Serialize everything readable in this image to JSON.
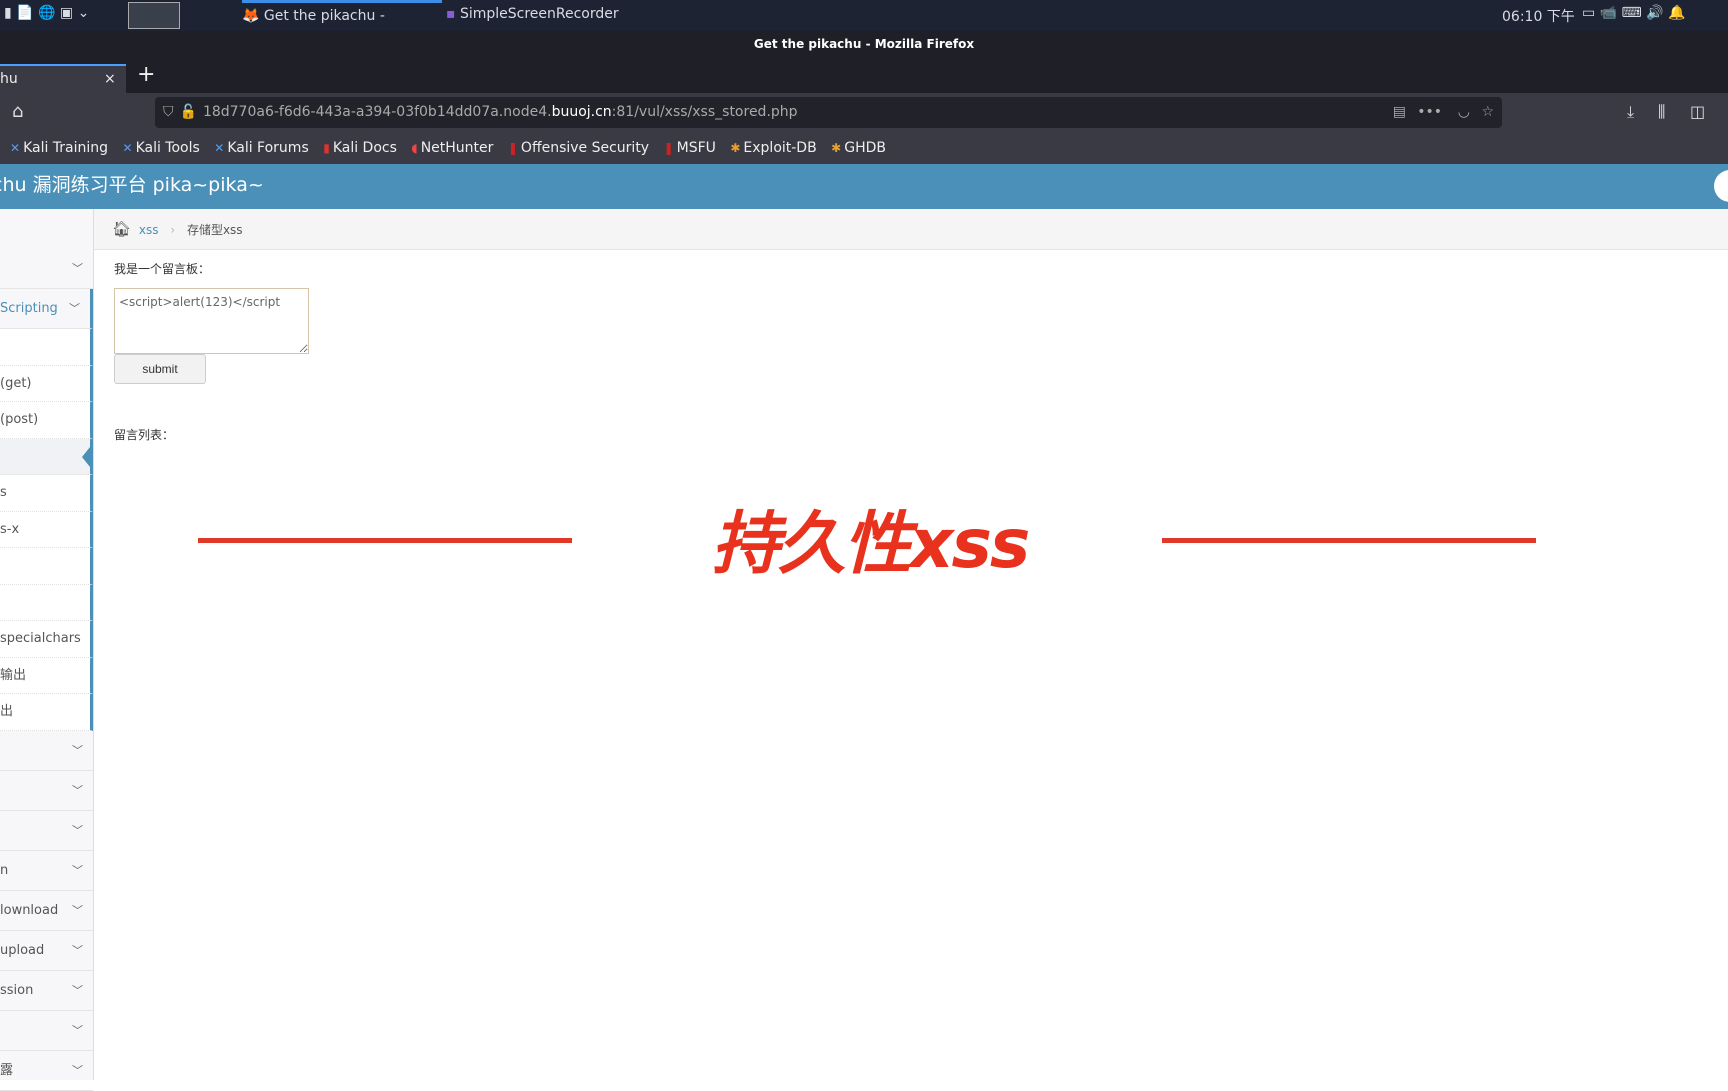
{
  "taskbar": {
    "windows": [
      {
        "label": "Get the pikachu - Mozilla..."
      },
      {
        "label": "SimpleScreenRecorder"
      }
    ],
    "clock": "06:10 下午"
  },
  "window_title": "Get the pikachu - Mozilla Firefox",
  "tab": {
    "label": "hu",
    "close": "×",
    "new_tab": "+"
  },
  "url": {
    "prefix": "18d770a6-f6d6-443a-a394-03f0b14dd07a.node4.",
    "domain": "buuoj.cn",
    "suffix": ":81/vul/xss/xss_stored.php"
  },
  "bookmarks": [
    "Kali Training",
    "Kali Tools",
    "Kali Forums",
    "Kali Docs",
    "NetHunter",
    "Offensive Security",
    "MSFU",
    "Exploit-DB",
    "GHDB"
  ],
  "header": {
    "title": "chu 漏洞练习平台 pika~pika~"
  },
  "sidebar": {
    "items": [
      {
        "label": "",
        "chevron": true
      },
      {
        "label": "Scripting",
        "chevron": true,
        "active": true
      },
      {
        "label": "",
        "sub": true
      },
      {
        "label": "(get)",
        "sub": true
      },
      {
        "label": "(post)",
        "sub": true
      },
      {
        "label": "",
        "sub": true,
        "current": true
      },
      {
        "label": "s",
        "sub": true
      },
      {
        "label": "s-x",
        "sub": true
      },
      {
        "label": "",
        "sub": true
      },
      {
        "label": "",
        "sub": true
      },
      {
        "label": "specialchars",
        "sub": true
      },
      {
        "label": "输出",
        "sub": true
      },
      {
        "label": "出",
        "sub": true
      },
      {
        "label": "",
        "chevron": true
      },
      {
        "label": "",
        "chevron": true
      },
      {
        "label": "",
        "chevron": true
      },
      {
        "label": "n",
        "chevron": true
      },
      {
        "label": "lownload",
        "chevron": true
      },
      {
        "label": "upload",
        "chevron": true
      },
      {
        "label": "ssion",
        "chevron": true
      },
      {
        "label": "",
        "chevron": true
      },
      {
        "label": "露",
        "chevron": true
      }
    ]
  },
  "breadcrumb": {
    "parent": "xss",
    "current": "存储型xss"
  },
  "form": {
    "label": "我是一个留言板：",
    "textarea_value": "<script>alert(123)</script",
    "submit": "submit"
  },
  "list_label": "留言列表：",
  "overlay_caption": "持久性xss",
  "colors": {
    "header": "#4a90b8",
    "caption": "#e8321e",
    "link": "#4a90b8"
  }
}
